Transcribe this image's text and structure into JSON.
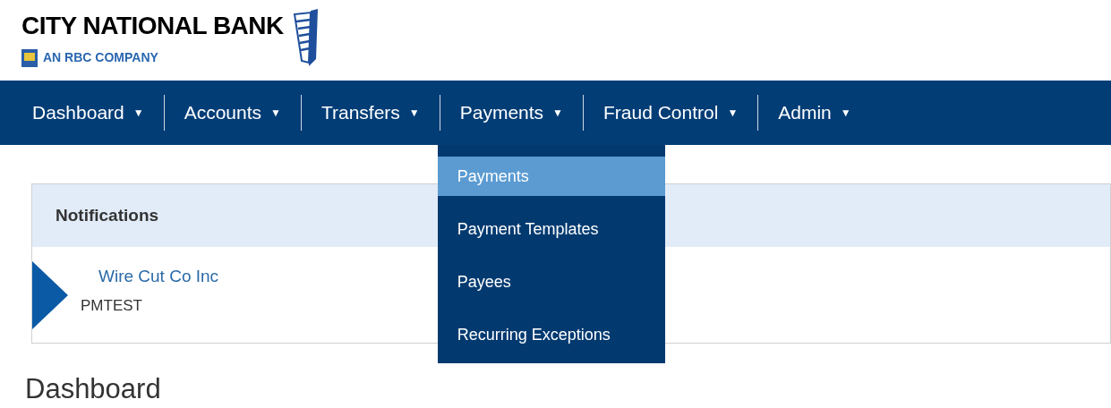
{
  "logo": {
    "name": "CITY NATIONAL BANK",
    "tagline": "AN RBC COMPANY"
  },
  "nav": [
    {
      "label": "Dashboard",
      "caret": "▼"
    },
    {
      "label": "Accounts",
      "caret": "▼"
    },
    {
      "label": "Transfers",
      "caret": "▼"
    },
    {
      "label": "Payments",
      "caret": "▼",
      "menu": [
        {
          "label": "Payments",
          "selected": true
        },
        {
          "label": "Payment Templates",
          "selected": false
        },
        {
          "label": "Payees",
          "selected": false
        },
        {
          "label": "Recurring Exceptions",
          "selected": false
        }
      ]
    },
    {
      "label": "Fraud Control",
      "caret": "▼"
    },
    {
      "label": "Admin",
      "caret": "▼"
    }
  ],
  "notifications": {
    "title": "Notifications",
    "items": [
      {
        "link": "Wire Cut Co Inc",
        "text": "PMTEST"
      }
    ]
  },
  "page_title": "Dashboard"
}
